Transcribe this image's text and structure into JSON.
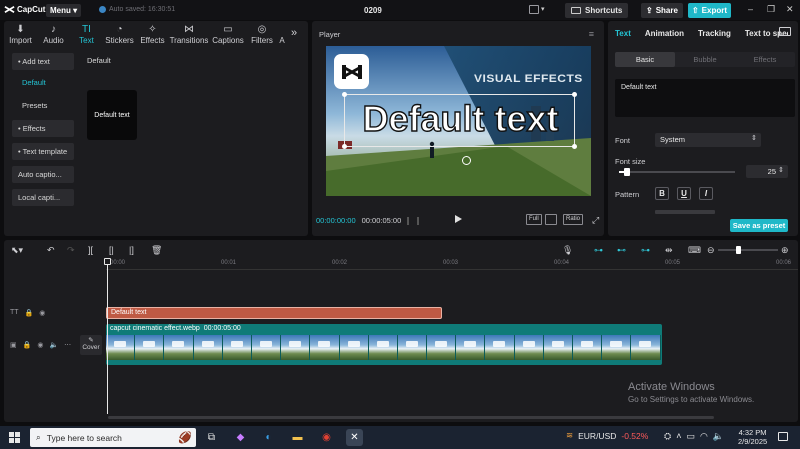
{
  "titlebar": {
    "app_name": "CapCut",
    "menu_label": "Menu",
    "autosave_text": "Auto saved: 16:30:51",
    "project_title": "0209",
    "shortcuts_label": "Shortcuts",
    "share_label": "Share",
    "export_label": "Export",
    "accent_color": "#1fb8c8"
  },
  "media_tabs": [
    {
      "label": "Import",
      "icon": "import-icon"
    },
    {
      "label": "Audio",
      "icon": "audio-icon"
    },
    {
      "label": "Text",
      "icon": "text-icon",
      "active": true
    },
    {
      "label": "Stickers",
      "icon": "sticker-icon"
    },
    {
      "label": "Effects",
      "icon": "effects-icon"
    },
    {
      "label": "Transitions",
      "icon": "transitions-icon"
    },
    {
      "label": "Captions",
      "icon": "captions-icon"
    },
    {
      "label": "Filters",
      "icon": "filters-icon"
    },
    {
      "label": "A",
      "icon": "adjust-icon"
    }
  ],
  "side_nav": {
    "add_text": "• Add text",
    "default": "Default",
    "presets": "Presets",
    "effects": "• Effects",
    "text_template": "• Text template",
    "auto_captions": "Auto captio...",
    "local_captions": "Local capti..."
  },
  "text_panel": {
    "section_label": "Default",
    "card_label": "Default text"
  },
  "player": {
    "title": "Player",
    "overlay_text": "Default text",
    "watermark_text": "VISUAL EFFECTS",
    "current_time": "00:00:00:00",
    "total_time": "00:00:05:00",
    "full_label": "Full",
    "ratio_label": "Ratio"
  },
  "right_panel": {
    "tabs": [
      "Text",
      "Animation",
      "Tracking",
      "Text to speech"
    ],
    "subtabs": [
      "Basic",
      "Bubble",
      "Effects"
    ],
    "text_value": "Default text",
    "font_label": "Font",
    "font_value": "System",
    "font_size_label": "Font size",
    "font_size_value": "25",
    "font_size_fraction": 0.07,
    "pattern_label": "Pattern",
    "pattern_buttons": [
      "B",
      "U",
      "I"
    ],
    "save_preset_label": "Save as preset"
  },
  "timeline": {
    "ruler_ticks": [
      "00:00",
      "00:01",
      "00:02",
      "00:03",
      "00:04",
      "00:05",
      "00:06"
    ],
    "text_clip_label": "Default text",
    "video_clip_name": "capcut cinematic effect.webp",
    "video_clip_duration": "00:00:05:00",
    "cover_label": "Cover"
  },
  "watermark": {
    "line1": "Activate Windows",
    "line2": "Go to Settings to activate Windows."
  },
  "taskbar": {
    "search_placeholder": "Type here to search",
    "fx_pair": "EUR/USD",
    "fx_change": "-0.52%",
    "time": "4:32 PM",
    "date": "2/9/2025"
  }
}
